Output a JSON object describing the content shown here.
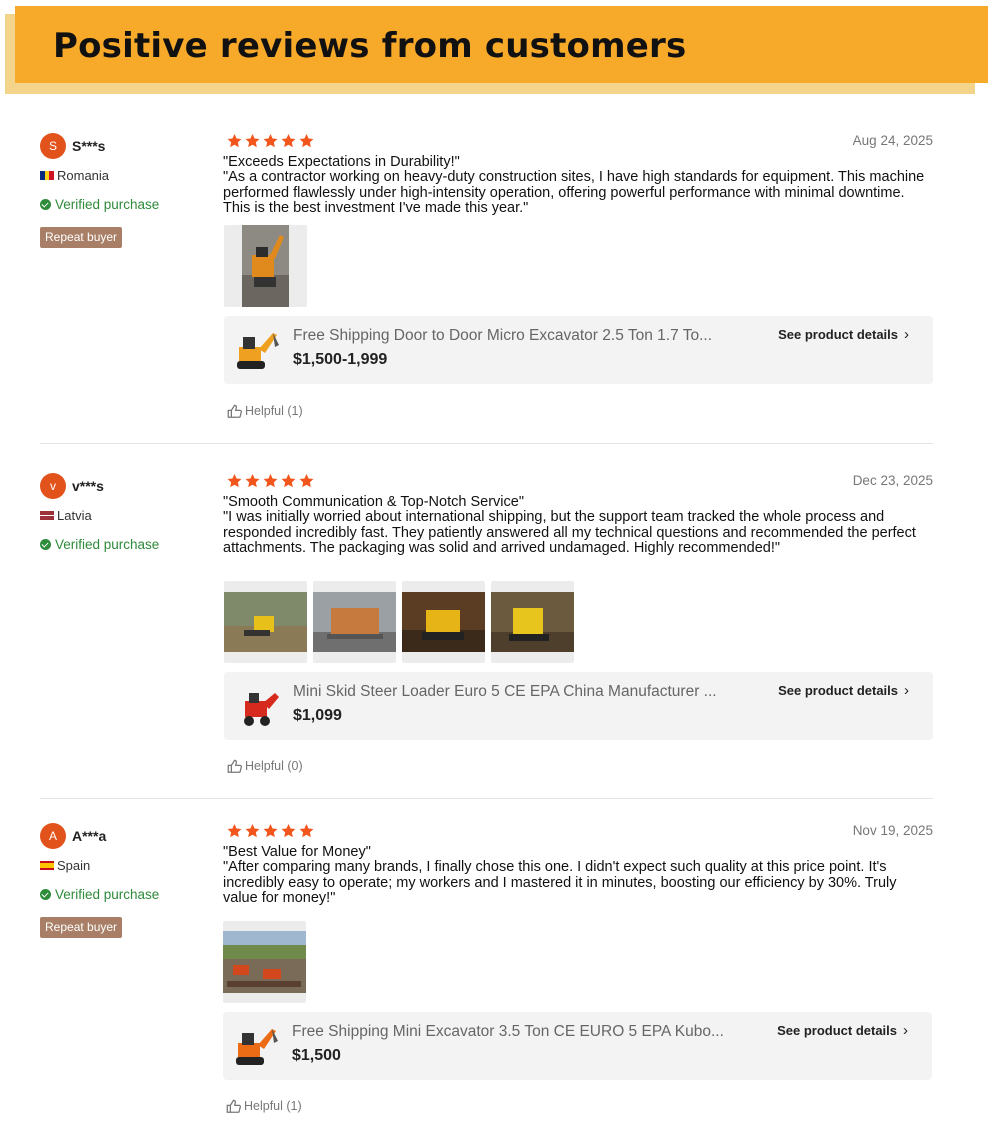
{
  "banner": {
    "title": "Positive reviews from customers"
  },
  "reviews": [
    {
      "avatar_initial": "S",
      "user": "S***s",
      "country": "Romania",
      "verified": "Verified purchase",
      "badge": "Repeat buyer",
      "rating": 5,
      "date": "Aug 24, 2025",
      "title": "\"Exceeds Expectations in Durability!\"",
      "text": "\"As a contractor working on heavy-duty construction sites, I have high standards for equipment. This machine performed flawlessly under high-intensity operation, offering powerful performance with minimal downtime. This is the best investment I've made this year.\"",
      "product_name": "Free Shipping Door to Door Micro Excavator 2.5 Ton 1.7 To...",
      "product_price": "$1,500-1,999",
      "product_link": "See product details",
      "helpful": "Helpful (1)"
    },
    {
      "avatar_initial": "v",
      "user": "v***s",
      "country": "Latvia",
      "verified": "Verified purchase",
      "badge": "",
      "rating": 5,
      "date": "Dec 23, 2025",
      "title": "\"Smooth Communication & Top-Notch Service\"",
      "text": "\"I was initially worried about international shipping, but the support team tracked the whole process and responded incredibly fast. They patiently answered all my technical questions and recommended the perfect attachments. The packaging was solid and arrived undamaged. Highly recommended!\"",
      "product_name": "Mini Skid Steer Loader Euro 5 CE EPA China Manufacturer ...",
      "product_price": "$1,099",
      "product_link": "See product details",
      "helpful": "Helpful (0)"
    },
    {
      "avatar_initial": "A",
      "user": "A***a",
      "country": "Spain",
      "verified": "Verified purchase",
      "badge": "Repeat buyer",
      "rating": 5,
      "date": "Nov 19, 2025",
      "title": "\"Best Value for Money\"",
      "text": "\"After comparing many brands, I finally chose this one. I didn't expect such quality at this price point. It's incredibly easy to operate; my workers and I mastered it in minutes, boosting our efficiency by 30%. Truly value for money!\"",
      "product_name": "Free Shipping Mini Excavator 3.5 Ton CE EURO 5 EPA Kubo...",
      "product_price": "$1,500",
      "product_link": "See product details",
      "helpful": "Helpful (1)"
    }
  ],
  "colors": {
    "banner": "#f7a92a",
    "star": "#f2561d",
    "verified": "#2e8b3a",
    "badge": "#a87f66",
    "avatar": "#e2531c"
  }
}
